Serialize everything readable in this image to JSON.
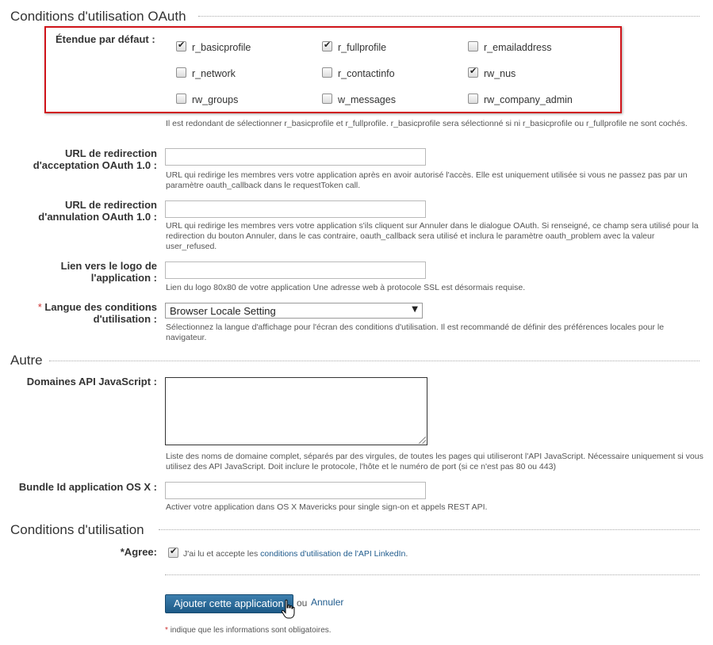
{
  "oauth_section": {
    "title": "Conditions d'utilisation OAuth",
    "scope_label": "Étendue par défaut :",
    "scopes": [
      {
        "name": "r_basicprofile",
        "checked": true
      },
      {
        "name": "r_fullprofile",
        "checked": true
      },
      {
        "name": "r_emailaddress",
        "checked": false
      },
      {
        "name": "r_network",
        "checked": false
      },
      {
        "name": "r_contactinfo",
        "checked": false
      },
      {
        "name": "rw_nus",
        "checked": true
      },
      {
        "name": "rw_groups",
        "checked": false
      },
      {
        "name": "w_messages",
        "checked": false
      },
      {
        "name": "rw_company_admin",
        "checked": false
      }
    ],
    "scope_help": "Il est redondant de sélectionner r_basicprofile et r_fullprofile. r_basicprofile sera sélectionné si ni r_basicprofile ou r_fullprofile ne sont cochés.",
    "accept_url": {
      "label_line1": "URL de redirection",
      "label_line2": "d'acceptation OAuth 1.0 :",
      "value": "",
      "help": "URL qui redirige les membres vers votre application après en avoir autorisé l'accès. Elle est uniquement utilisée si vous ne passez pas par un paramètre oauth_callback dans le requestToken call."
    },
    "cancel_url": {
      "label_line1": "URL de redirection",
      "label_line2": "d'annulation OAuth 1.0 :",
      "value": "",
      "help": "URL qui redirige les membres vers votre application s'ils cliquent sur Annuler dans le dialogue OAuth. Si renseigné, ce champ sera utilisé pour la redirection du bouton Annuler, dans le cas contraire, oauth_callback sera utilisé et inclura le paramètre oauth_problem avec la valeur user_refused."
    },
    "logo_url": {
      "label_line1": "Lien vers le logo de",
      "label_line2": "l'application :",
      "value": "",
      "help": "Lien du logo 80x80 de votre application Une adresse web à protocole SSL est désormais requise."
    },
    "language": {
      "required_mark": "*",
      "label_line1": "Langue des conditions",
      "label_line2": "d'utilisation :",
      "selected": "Browser Locale Setting",
      "help": "Sélectionnez la langue d'affichage pour l'écran des conditions d'utilisation. Il est recommandé de définir des préférences locales pour le navigateur."
    }
  },
  "other_section": {
    "title": "Autre",
    "js_domains": {
      "label": "Domaines API JavaScript :",
      "value": "",
      "help": "Liste des noms de domaine complet, séparés par des virgules, de toutes les pages qui utiliseront l'API JavaScript. Nécessaire uniquement si vous utilisez des API JavaScript. Doit inclure le protocole, l'hôte et le numéro de port (si ce n'est pas 80 ou 443)"
    },
    "bundle_id": {
      "label": "Bundle Id application OS X :",
      "value": "",
      "help": "Activer votre application dans OS X Mavericks pour single sign-on et appels REST API."
    }
  },
  "terms_section": {
    "title": "Conditions d'utilisation",
    "agree_label": "*Agree:",
    "agree_checked": true,
    "agree_text": "J'ai lu et accepte les",
    "agree_link": "conditions d'utilisation de l'API LinkedIn",
    "agree_period": "."
  },
  "actions": {
    "submit_label": "Ajouter cette application",
    "or_text": "ou",
    "cancel_label": "Annuler",
    "required_mark": "*",
    "required_note": "indique que les informations sont obligatoires."
  },
  "icons": {
    "checkmark": "checkmark-icon",
    "dropdown": "dropdown-arrow-icon",
    "cursor": "hand-pointer-icon"
  },
  "colors": {
    "highlight_border": "#d0141a",
    "button_top": "#3d7fae",
    "button_bottom": "#1d5a87",
    "link": "#1e5a8c",
    "required": "#c33"
  }
}
